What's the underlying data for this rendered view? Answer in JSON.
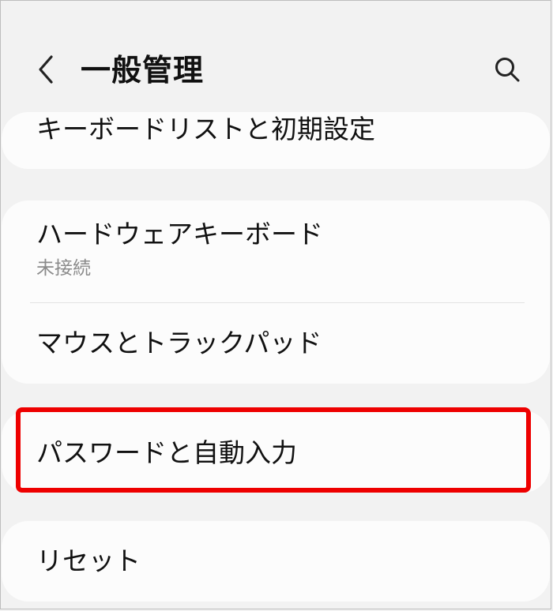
{
  "header": {
    "title": "一般管理"
  },
  "items": {
    "keyboard_list": {
      "label": "キーボードリストと初期設定"
    },
    "hardware_keyboard": {
      "label": "ハードウェアキーボード",
      "status": "未接続"
    },
    "mouse_trackpad": {
      "label": "マウスとトラックパッド"
    },
    "password_autofill": {
      "label": "パスワードと自動入力"
    },
    "reset": {
      "label": "リセット"
    }
  },
  "highlight_color": "#ee0000"
}
